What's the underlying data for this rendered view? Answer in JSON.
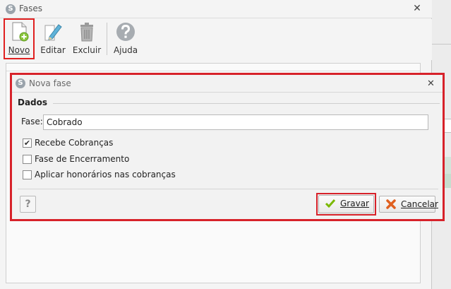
{
  "window": {
    "title": "Fases",
    "logo_letter": "S",
    "close_glyph": "✕"
  },
  "toolbar": {
    "new_label": "Novo",
    "edit_label": "Editar",
    "delete_label": "Excluir",
    "help_label": "Ajuda"
  },
  "dialog": {
    "title": "Nova fase",
    "logo_letter": "S",
    "close_glyph": "✕",
    "group_title": "Dados",
    "phase_label": "Fase:",
    "phase_value": "Cobrado",
    "options": [
      {
        "label": "Recebe Cobranças",
        "checked": true
      },
      {
        "label": "Fase de Encerramento",
        "checked": false
      },
      {
        "label": "Aplicar honorários nas cobranças",
        "checked": false
      }
    ],
    "help_glyph": "?",
    "save_label": "Gravar",
    "cancel_label": "Cancelar"
  },
  "colors": {
    "highlight": "#d7222a",
    "save_icon": "#7ab800",
    "cancel_icon": "#e06020"
  }
}
